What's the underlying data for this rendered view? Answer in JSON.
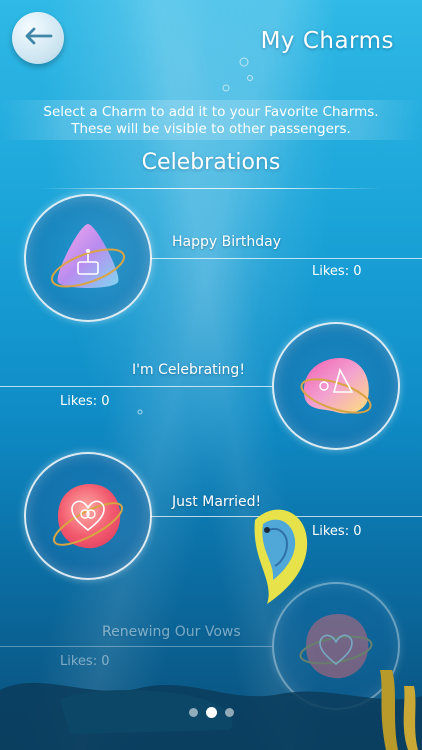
{
  "header": {
    "back_icon": "arrow-left-icon",
    "title": "My Charms"
  },
  "info": {
    "line1": "Select a Charm to add it to your Favorite Charms.",
    "line2": "These will be visible to other passengers."
  },
  "section": {
    "title": "Celebrations"
  },
  "charms": [
    {
      "label": "Happy Birthday",
      "likes": "Likes: 0",
      "icon": "birthday-cake-charm-icon",
      "color": "#b98cf0"
    },
    {
      "label": "I'm Celebrating!",
      "likes": "Likes: 0",
      "icon": "party-hat-charm-icon",
      "color": "#f07ac0"
    },
    {
      "label": "Just Married!",
      "likes": "Likes: 0",
      "icon": "rings-heart-charm-icon",
      "color": "#f25a6e"
    },
    {
      "label": "Renewing Our Vows",
      "likes": "Likes: 0",
      "icon": "heart-charm-icon",
      "color": "#f26b78"
    }
  ],
  "pager": {
    "pages": 3,
    "active_page": 2
  }
}
